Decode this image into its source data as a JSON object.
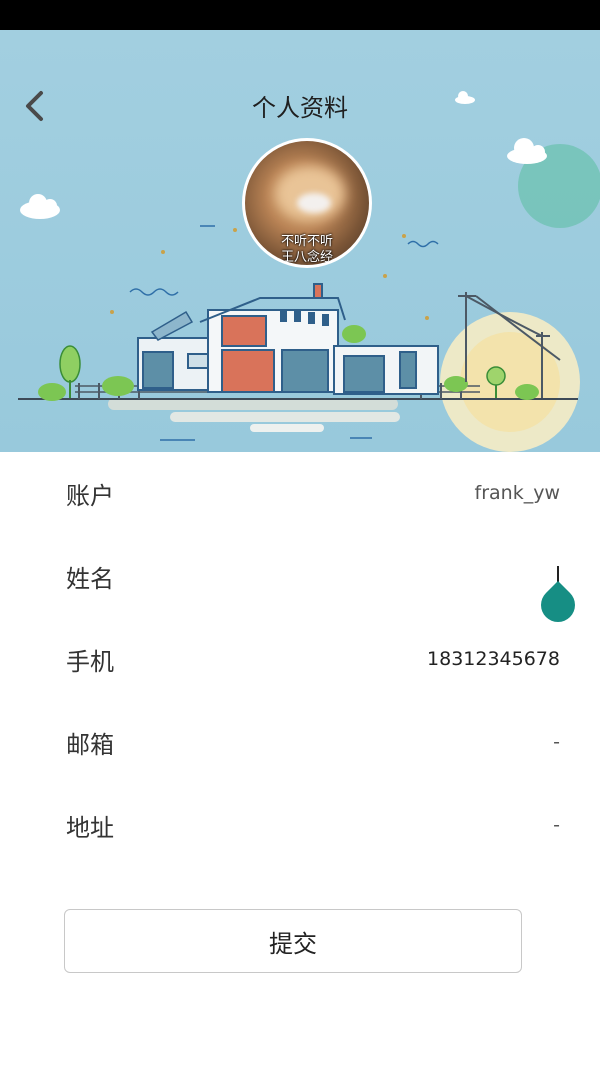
{
  "header": {
    "title": "个人资料",
    "avatar_caption_line1": "不听不听",
    "avatar_caption_line2": "王八念经"
  },
  "profile": {
    "rows": [
      {
        "label": "账户",
        "value": "frank_yw"
      },
      {
        "label": "姓名",
        "value": ""
      },
      {
        "label": "手机",
        "value": "18312345678"
      },
      {
        "label": "邮箱",
        "value": "-"
      },
      {
        "label": "地址",
        "value": "-"
      }
    ]
  },
  "actions": {
    "submit_label": "提交"
  },
  "colors": {
    "header_bg": "#a2cfe0",
    "accent_teal": "#168e84"
  }
}
